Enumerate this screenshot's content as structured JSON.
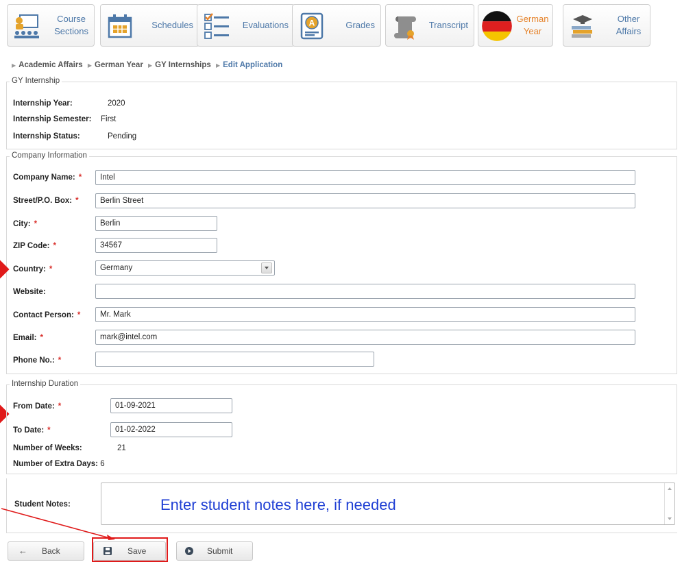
{
  "nav": {
    "tiles": [
      {
        "label1": "Course",
        "label2": "Sections"
      },
      {
        "label1": "Schedules"
      },
      {
        "label1": "Evaluations"
      },
      {
        "label1": "Grades"
      },
      {
        "label1": "Transcript"
      },
      {
        "label1": "German",
        "label2": "Year"
      },
      {
        "label1": "Other",
        "label2": "Affairs"
      }
    ]
  },
  "breadcrumb": [
    "Academic Affairs",
    "German Year",
    "GY Internships",
    "Edit Application"
  ],
  "gy_internship": {
    "legend": "GY Internship",
    "year_label": "Internship Year:",
    "year": "2020",
    "semester_label": "Internship Semester:",
    "semester": "First",
    "status_label": "Internship Status:",
    "status": "Pending"
  },
  "company": {
    "legend": "Company Information",
    "name_label": "Company Name:",
    "name": "Intel",
    "street_label": "Street/P.O. Box:",
    "street": "Berlin Street",
    "city_label": "City:",
    "city": "Berlin",
    "zip_label": "ZIP Code:",
    "zip": "34567",
    "country_label": "Country:",
    "country": "Germany",
    "website_label": "Website:",
    "website": "",
    "contact_label": "Contact Person:",
    "contact": "Mr. Mark",
    "email_label": "Email:",
    "email": "mark@intel.com",
    "phone_label": "Phone No.:",
    "phone": ""
  },
  "duration": {
    "legend": "Internship Duration",
    "from_label": "From Date:",
    "from": "01-09-2021",
    "to_label": "To Date:",
    "to": "01-02-2022",
    "weeks_label": "Number of Weeks:",
    "weeks": "21",
    "extra_label": "Number of Extra Days:",
    "extra": "6"
  },
  "notes": {
    "label": "Student Notes:",
    "hint": "Enter student notes here, if needed"
  },
  "buttons": {
    "back": "Back",
    "save": "Save",
    "submit": "Submit"
  },
  "colors": {
    "link": "#4d78a8",
    "active": "#e5832b",
    "required": "#d9302c",
    "annotation": "#e01a1a"
  }
}
